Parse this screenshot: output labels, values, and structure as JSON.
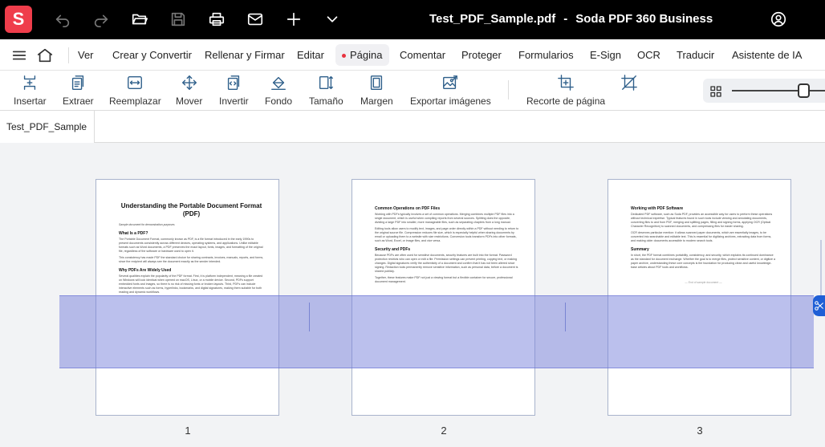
{
  "app": {
    "logo_letter": "S",
    "file_name": "Test_PDF_Sample.pdf",
    "separator": "-",
    "product_name": "Soda PDF 360 Business",
    "accent": "#ef3d4b"
  },
  "titlebar_icons": [
    "undo-icon",
    "redo-icon",
    "folder-open-icon",
    "save-icon",
    "print-icon",
    "mail-icon",
    "plus-icon",
    "chevron-down-icon",
    "account-icon"
  ],
  "menu": {
    "items": [
      {
        "label": "Ver"
      },
      {
        "label": "Crear y Convertir"
      },
      {
        "label": "Rellenar y Firmar"
      },
      {
        "label": "Editar"
      },
      {
        "label": "Página",
        "active": true
      },
      {
        "label": "Comentar"
      },
      {
        "label": "Proteger"
      },
      {
        "label": "Formularios"
      },
      {
        "label": "E-Sign"
      },
      {
        "label": "OCR"
      },
      {
        "label": "Traducir"
      },
      {
        "label": "Asistente de IA"
      }
    ]
  },
  "toolbar": {
    "tools": [
      {
        "label": "Insertar",
        "icon": "insert-pages-icon"
      },
      {
        "label": "Extraer",
        "icon": "extract-pages-icon"
      },
      {
        "label": "Reemplazar",
        "icon": "replace-pages-icon"
      },
      {
        "label": "Mover",
        "icon": "move-arrows-icon"
      },
      {
        "label": "Invertir",
        "icon": "reverse-pages-icon"
      },
      {
        "label": "Fondo",
        "icon": "paint-bucket-icon"
      },
      {
        "label": "Tamaño",
        "icon": "page-size-icon"
      },
      {
        "label": "Margen",
        "icon": "margin-icon"
      },
      {
        "label": "Exportar imágenes",
        "icon": "export-images-icon"
      },
      {
        "label": "Recorte de página",
        "icon": "crop-page-icon"
      },
      {
        "label": "",
        "icon": "crop-off-icon"
      }
    ],
    "view_icon": "grid-view-icon"
  },
  "tabs": [
    {
      "label": "Test_PDF_Sample"
    }
  ],
  "pages": [
    {
      "number": "1",
      "title": "Understanding the Portable Document Format (PDF)",
      "subtitle": "Sample document for demonstration purposes",
      "sections": [
        {
          "heading": "What Is a PDF?",
          "paragraphs": [
            "The Portable Document Format, commonly known as PDF, is a file format introduced in the early 1990s to present documents consistently across different devices, operating systems, and applications. Unlike editable formats such as Word documents, a PDF preserves the exact layout, fonts, images, and formatting of the original file, regardless of the software or hardware used to open it.",
            "This consistency has made PDF the standard choice for sharing contracts, invoices, manuals, reports, and forms, since the recipient will always see the document exactly as the sender intended."
          ]
        },
        {
          "heading": "Why PDFs Are Widely Used",
          "paragraphs": [
            "Several qualities explain the popularity of the PDF format. First, it is platform independent, meaning a file created on Windows will look identical when opened on macOS, Linux, or a mobile device. Second, PDFs support embedded fonts and images, so there is no risk of missing fonts or broken layouts. Third, PDFs can include interactive elements such as forms, hyperlinks, bookmarks, and digital signatures, making them suitable for both reading and dynamic workflows."
          ]
        }
      ],
      "footer": ""
    },
    {
      "number": "2",
      "title": "",
      "subtitle": "",
      "sections": [
        {
          "heading": "Common Operations on PDF Files",
          "paragraphs": [
            "Working with PDFs typically involves a set of common operations. Merging combines multiple PDF files into a single document, which is useful when compiling reports from several sources. Splitting does the opposite, dividing a large PDF into smaller, more manageable files, such as separating chapters from a long manual.",
            "Editing tools allow users to modify text, images, and page order directly within a PDF without needing to return to the original source file. Compression reduces file size, which is especially helpful when sharing documents by email or uploading them to a website with size restrictions. Conversion tools transform PDFs into other formats, such as Word, Excel, or image files, and vice versa."
          ]
        },
        {
          "heading": "Security and PDFs",
          "paragraphs": [
            "Because PDFs are often used for sensitive documents, security features are built into the format. Password protection restricts who can open or edit a file. Permission settings can prevent printing, copying text, or making changes. Digital signatures verify the authenticity of a document and confirm that it has not been altered since signing. Redaction tools permanently remove sensitive information, such as personal data, before a document is shared publicly.",
            "Together, these features make PDF not just a viewing format but a flexible container for secure, professional document management."
          ]
        }
      ],
      "footer": ""
    },
    {
      "number": "3",
      "title": "",
      "subtitle": "",
      "sections": [
        {
          "heading": "Working with PDF Software",
          "paragraphs": [
            "Dedicated PDF software, such as Soda PDF, provides an accessible way for users to perform these operations without technical expertise. Typical features found in such tools include viewing and annotating documents, converting files to and from PDF, merging and splitting pages, filling and signing forms, applying OCR (Optical Character Recognition) to scanned documents, and compressing files for easier sharing.",
            "OCR deserves particular mention: it allows scanned paper documents, which are essentially images, to be converted into searchable and editable text. This is essential for digitizing archives, extracting data from forms, and making older documents accessible to modern search tools."
          ]
        },
        {
          "heading": "Summary",
          "paragraphs": [
            "In short, the PDF format combines portability, consistency, and security, which explains its continued dominance as the standard for document exchange. Whether the goal is to merge files, protect sensitive content, or digitize a paper archive, understanding these core concepts is the foundation for producing clean and useful knowledge-base articles about PDF tools and workflows."
          ]
        }
      ],
      "footer": "— End of sample document —"
    }
  ],
  "selection": {
    "color": "#7882dc",
    "tool_icon": "scissors-icon"
  }
}
